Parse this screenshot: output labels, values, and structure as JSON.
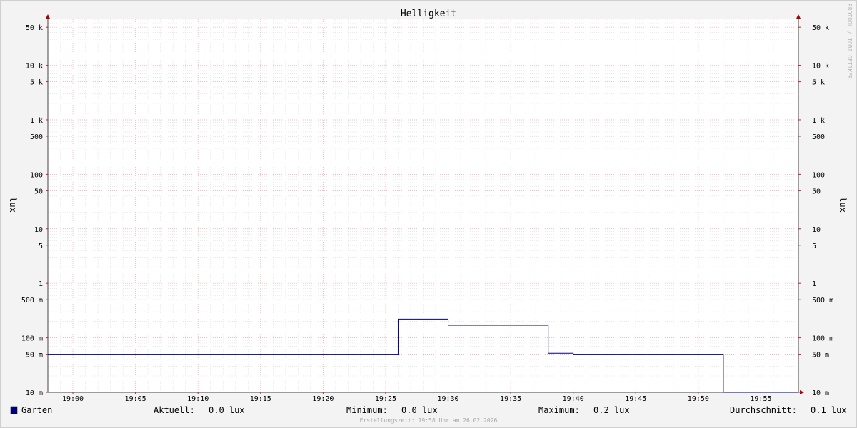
{
  "chart_data": {
    "type": "line",
    "title": "Helligkeit",
    "ylabel": "lux",
    "yscale": "log",
    "ylim": [
      0.01,
      70000
    ],
    "y_ticks": [
      {
        "value": 50000,
        "label": "50 k"
      },
      {
        "value": 10000,
        "label": "10 k"
      },
      {
        "value": 5000,
        "label": "5 k"
      },
      {
        "value": 1000,
        "label": "1 k"
      },
      {
        "value": 500,
        "label": "500"
      },
      {
        "value": 100,
        "label": "100"
      },
      {
        "value": 50,
        "label": "50"
      },
      {
        "value": 10,
        "label": "10"
      },
      {
        "value": 5,
        "label": "5"
      },
      {
        "value": 1,
        "label": "1"
      },
      {
        "value": 0.5,
        "label": "500 m"
      },
      {
        "value": 0.1,
        "label": "100 m"
      },
      {
        "value": 0.05,
        "label": "50 m"
      },
      {
        "value": 0.01,
        "label": "10 m"
      }
    ],
    "x_ticks": [
      "19:00",
      "19:05",
      "19:10",
      "19:15",
      "19:20",
      "19:25",
      "19:30",
      "19:35",
      "19:40",
      "19:45",
      "19:50",
      "19:55"
    ],
    "xlim": [
      "18:58",
      "19:58"
    ],
    "grid": true,
    "series": [
      {
        "name": "Garten",
        "color": "#000080",
        "step": true,
        "x": [
          "18:58",
          "19:26",
          "19:30",
          "19:38",
          "19:40",
          "19:52",
          "19:58"
        ],
        "y": [
          0.05,
          0.22,
          0.17,
          0.052,
          0.05,
          0.01,
          0.01
        ]
      }
    ]
  },
  "legend": {
    "series_name": "Garten",
    "swatch_color": "#000080",
    "current_label": "Aktuell:",
    "current_value": "0.0 lux",
    "min_label": "Minimum:",
    "min_value": "0.0 lux",
    "max_label": "Maximum:",
    "max_value": "0.2 lux",
    "avg_label": "Durchschnitt:",
    "avg_value": "0.1 lux"
  },
  "footer": "Erstellungszeit: 19:58 Uhr am 26.02.2026",
  "watermark": "RRDTOOL / TOBI OETIKER"
}
